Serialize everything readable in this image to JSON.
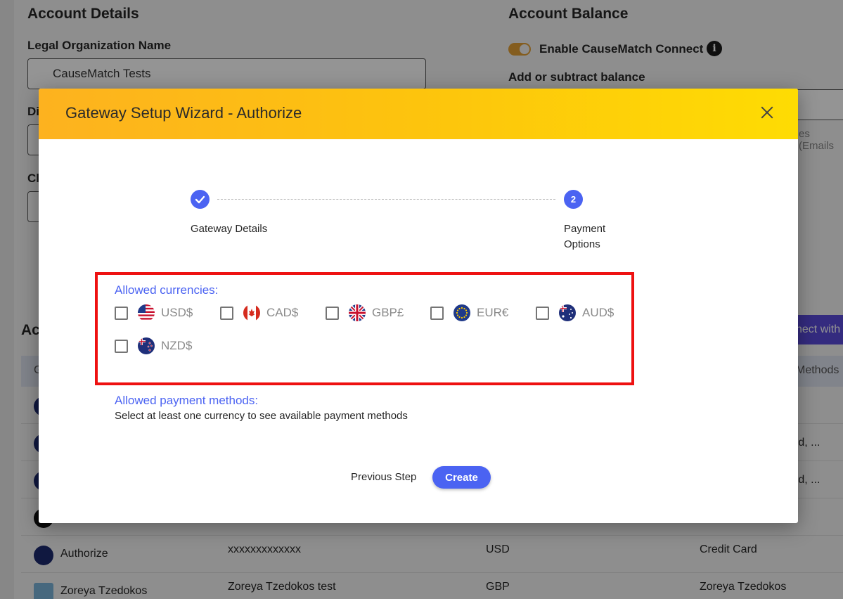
{
  "background": {
    "account_details": {
      "title": "Account Details",
      "legal_org_label": "Legal Organization Name",
      "legal_org_value": "CauseMatch Tests",
      "partial_label_1": "Di",
      "partial_label_2": "Cl"
    },
    "account_balance": {
      "title": "Account Balance",
      "connect_label": "Enable CauseMatch Connect",
      "add_subtract_label": "Add or subtract balance",
      "partial_text": "es (Emails"
    },
    "accounts_section_partial": "Ac",
    "connect_button_partial": "nect with",
    "table": {
      "partial_col_first": "G",
      "partial_col_methods": "Methods",
      "partial_cells": [
        "rd, ...",
        "rd, ..."
      ],
      "rows": [
        {
          "name": "Authorize",
          "account": "xxxxxxxxxxxxx",
          "currency": "USD",
          "methods": "Credit Card"
        },
        {
          "name": "Zoreya Tzedokos",
          "account": "Zoreya Tzedokos test",
          "currency": "GBP",
          "methods": "Zoreya Tzedokos"
        }
      ]
    }
  },
  "modal": {
    "title": "Gateway Setup Wizard - Authorize",
    "steps": [
      {
        "number": "✓",
        "label": "Gateway Details",
        "completed": true
      },
      {
        "number": "2",
        "label_line1": "Payment",
        "label_line2": "Options",
        "completed": false
      }
    ],
    "allowed_currencies_title": "Allowed currencies:",
    "currencies": [
      {
        "code": "USD$",
        "flag": "us-flag-icon",
        "checked": false
      },
      {
        "code": "CAD$",
        "flag": "ca-flag-icon",
        "checked": false
      },
      {
        "code": "GBP£",
        "flag": "gb-flag-icon",
        "checked": false
      },
      {
        "code": "EUR€",
        "flag": "eu-flag-icon",
        "checked": false
      },
      {
        "code": "AUD$",
        "flag": "au-flag-icon",
        "checked": false
      },
      {
        "code": "NZD$",
        "flag": "nz-flag-icon",
        "checked": false
      }
    ],
    "allowed_payment_methods_title": "Allowed payment methods:",
    "payment_methods_hint": "Select at least one currency to see available payment methods",
    "previous_button": "Previous Step",
    "create_button": "Create"
  },
  "colors": {
    "accent": "#4b63f2",
    "header_gradient_start": "#fdb21f",
    "header_gradient_end": "#fedc03",
    "highlight": "#ee1111"
  }
}
